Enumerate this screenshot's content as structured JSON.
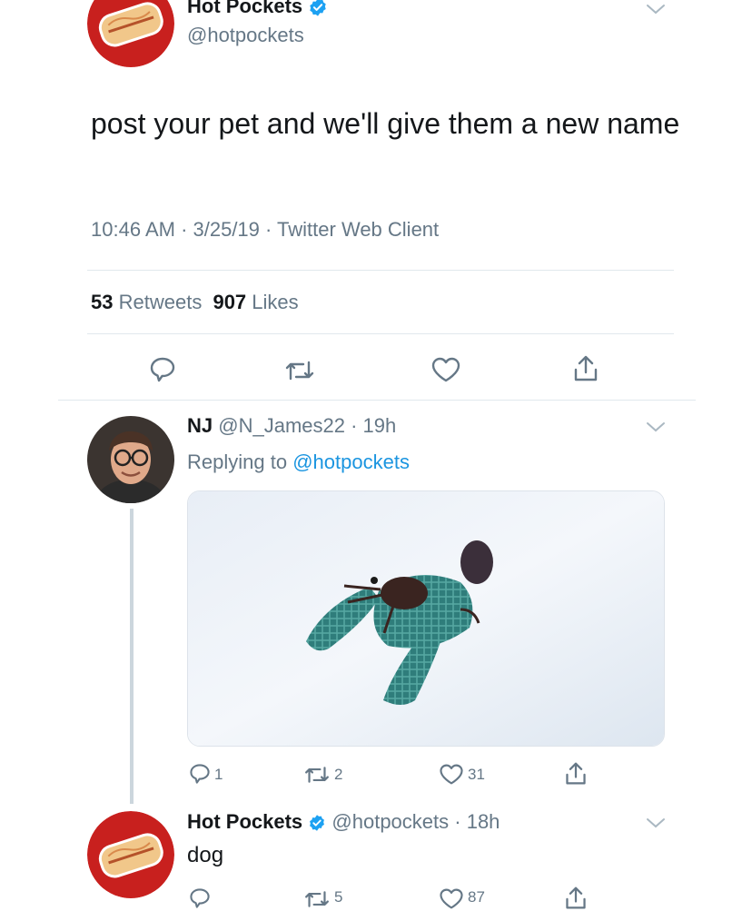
{
  "main_tweet": {
    "display_name": "Hot Pockets",
    "handle": "@hotpockets",
    "text": "post your pet and we'll give them a new name",
    "meta": "10:46 AM · 3/25/19 · Twitter Web Client",
    "stats": {
      "retweets_count": "53",
      "retweets_label": "Retweets",
      "likes_count": "907",
      "likes_label": "Likes"
    }
  },
  "reply": {
    "display_name": "NJ",
    "handle": "@N_James22",
    "time": "· 19h",
    "replying_label": "Replying to",
    "replying_handle": "@hotpockets",
    "actions": {
      "replies": "1",
      "retweets": "2",
      "likes": "31"
    }
  },
  "reply2": {
    "display_name": "Hot Pockets",
    "handle": "@hotpockets",
    "time": "· 18h",
    "text": "dog",
    "actions": {
      "retweets": "5",
      "likes": "87"
    }
  },
  "colors": {
    "text": "#14171a",
    "secondary": "#657786",
    "link": "#1b95e0",
    "verified": "#1da1f2",
    "divider": "#e1e8ed",
    "brand_red": "#c8201e"
  },
  "icons": [
    "verified-badge-icon",
    "chevron-down-icon",
    "reply-icon",
    "retweet-icon",
    "like-icon",
    "share-icon"
  ]
}
